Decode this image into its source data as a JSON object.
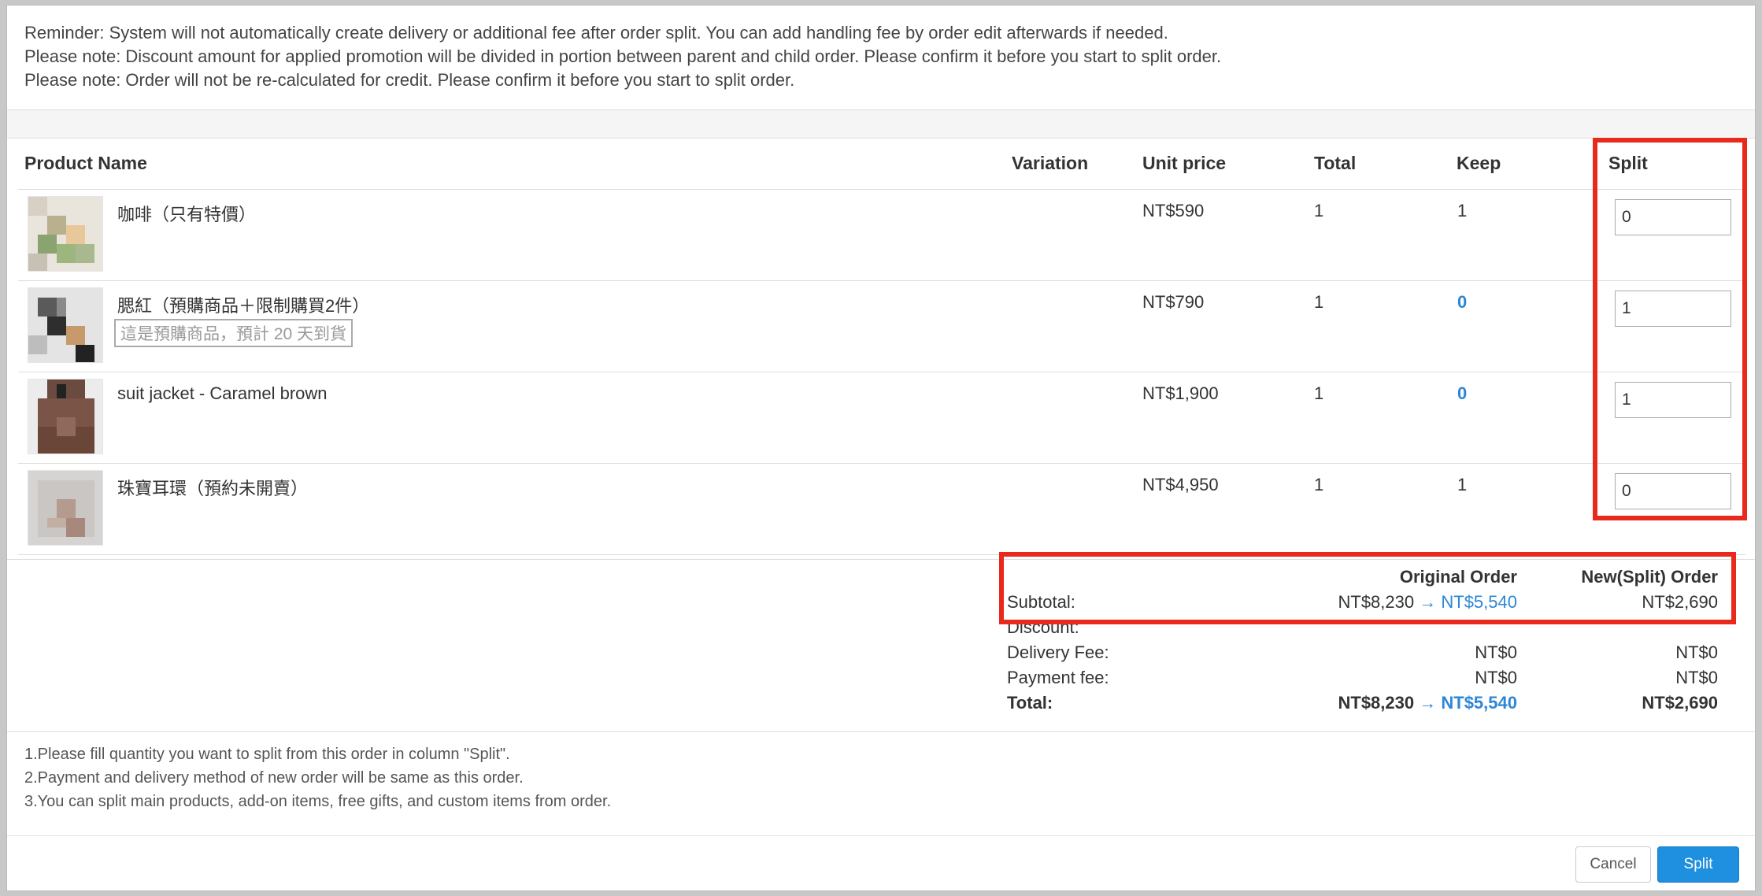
{
  "notice": {
    "line1": "Reminder: System will not automatically create delivery or additional fee after order split. You can add handling fee by order edit afterwards if needed.",
    "line2": "Please note: Discount amount for applied promotion will be divided in portion between parent and child order. Please confirm it before you start to split order.",
    "line3": "Please note: Order will not be re-calculated for credit. Please confirm it before you start to split order."
  },
  "table": {
    "headers": {
      "product_name": "Product Name",
      "variation": "Variation",
      "unit_price": "Unit price",
      "total": "Total",
      "keep": "Keep",
      "split": "Split"
    },
    "rows": [
      {
        "name": "咖啡（只有特價）",
        "tag": "",
        "price": "NT$590",
        "total": "1",
        "keep": "1",
        "keep_highlight": false,
        "split": "0"
      },
      {
        "name": "腮紅（預購商品＋限制購買2件）",
        "tag": "這是預購商品，預計 20 天到貨",
        "price": "NT$790",
        "total": "1",
        "keep": "0",
        "keep_highlight": true,
        "split": "1"
      },
      {
        "name": "suit jacket - Caramel brown",
        "tag": "",
        "price": "NT$1,900",
        "total": "1",
        "keep": "0",
        "keep_highlight": true,
        "split": "1"
      },
      {
        "name": "珠寶耳環（預約未開賣）",
        "tag": "",
        "price": "NT$4,950",
        "total": "1",
        "keep": "1",
        "keep_highlight": false,
        "split": "0"
      }
    ]
  },
  "summary": {
    "original_header": "Original Order",
    "new_header": "New(Split) Order",
    "subtotal_label": "Subtotal:",
    "subtotal_original_from": "NT$8,230",
    "arrow": "→",
    "subtotal_original_to": "NT$5,540",
    "subtotal_new": "NT$2,690",
    "discount_label": "Discount:",
    "delivery_label": "Delivery Fee:",
    "delivery_original": "NT$0",
    "delivery_new": "NT$0",
    "payment_label": "Payment fee:",
    "payment_original": "NT$0",
    "payment_new": "NT$0",
    "total_label": "Total:",
    "total_original_from": "NT$8,230",
    "total_original_to": "NT$5,540",
    "total_new": "NT$2,690"
  },
  "instructions": {
    "line1": "1.Please fill quantity you want to split from this order in column \"Split\".",
    "line2": "2.Payment and delivery method of new order will be same as this order.",
    "line3": "3.You can split main products, add-on items, free gifts, and custom items from order."
  },
  "buttons": {
    "cancel": "Cancel",
    "split": "Split"
  },
  "colors": {
    "accent": "#2e86d6",
    "primary_button": "#1f8fe0",
    "highlight_box": "#e8291c"
  }
}
